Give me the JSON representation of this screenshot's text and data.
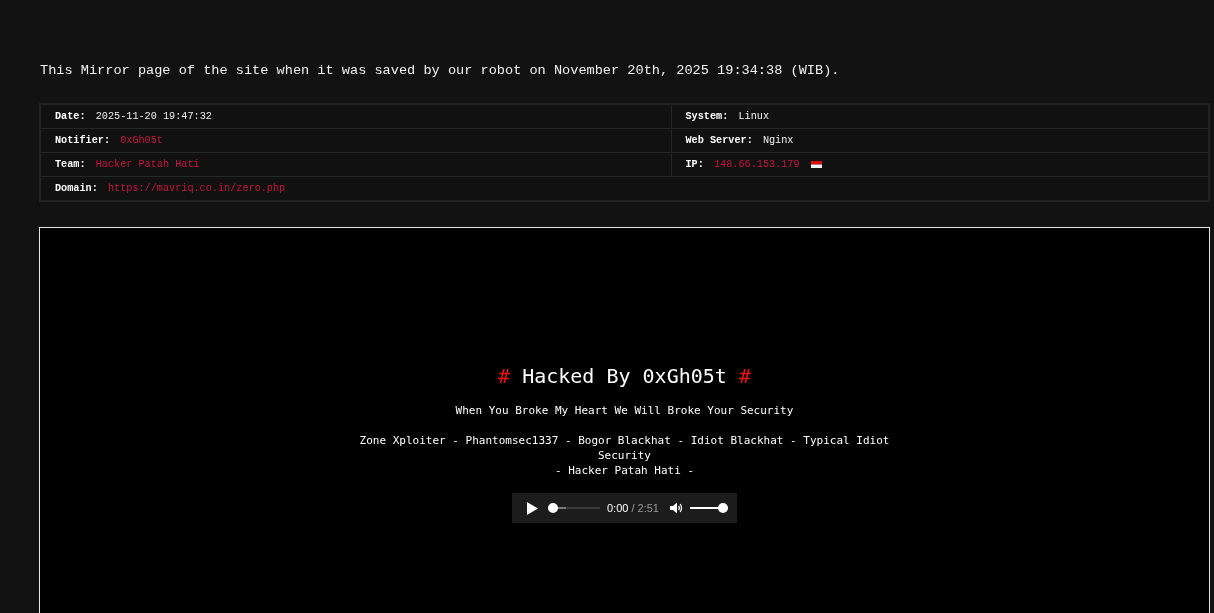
{
  "intro": "This Mirror page of the site when it was saved by our robot on November 20th, 2025 19:34:38 (WIB).",
  "details": [
    {
      "cells": [
        {
          "label": "Date:",
          "value": "2025-11-20 19:47:32",
          "kind": "text"
        },
        {
          "label": "System:",
          "value": "Linux",
          "kind": "text"
        }
      ]
    },
    {
      "cells": [
        {
          "label": "Notifier:",
          "value": "0xGh05t",
          "kind": "link"
        },
        {
          "label": "Web Server:",
          "value": "Nginx",
          "kind": "text"
        }
      ]
    },
    {
      "cells": [
        {
          "label": "Team:",
          "value": "Hacker Patah Hati",
          "kind": "link"
        },
        {
          "label": "IP:",
          "value": "148.66.153.179",
          "kind": "link",
          "flag": true
        }
      ]
    },
    {
      "cells": [
        {
          "label": "Domain:",
          "value": "https://mavriq.co.in/zero.php",
          "kind": "link"
        }
      ]
    }
  ],
  "mirror": {
    "heading": {
      "left_mark": "#",
      "text": "Hacked By 0xGh05t",
      "right_mark": "#"
    },
    "tagline": "When You Broke My Heart We Will Broke Your Security",
    "groups": "Zone Xploiter - Phantomsec1337 - Bogor Blackhat - Idiot Blackhat - Typical Idiot Security",
    "team": "- Hacker Patah Hati -",
    "audio": {
      "progress": {
        "level": 0,
        "buffered": {
          "level": 0.35
        }
      },
      "elapsed": "0:00",
      "duration": "/ 2:51",
      "volume": {
        "level": 1
      }
    }
  }
}
